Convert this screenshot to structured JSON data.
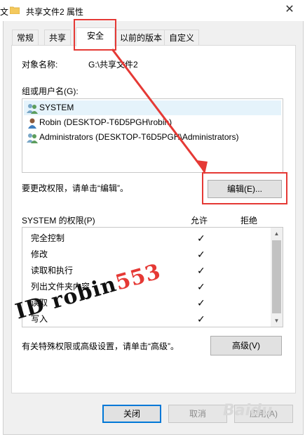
{
  "window": {
    "left_edge_char": "文",
    "title": "共享文件2 属性",
    "close": "✕"
  },
  "tabs": [
    {
      "label": "常规"
    },
    {
      "label": "共享"
    },
    {
      "label": "安全"
    },
    {
      "label": "以前的版本"
    },
    {
      "label": "自定义"
    }
  ],
  "security": {
    "object_name_label": "对象名称:",
    "object_name_value": "G:\\共享文件2",
    "group_label": "组或用户名(G):",
    "users": [
      {
        "name": "SYSTEM"
      },
      {
        "name": "Robin (DESKTOP-T6D5PGH\\robin)"
      },
      {
        "name": "Administrators (DESKTOP-T6D5PGH\\Administrators)"
      }
    ],
    "change_hint": "要更改权限，请单击“编辑”。",
    "edit_button": "编辑(E)...",
    "perm_label": "SYSTEM 的权限(P)",
    "allow_header": "允许",
    "deny_header": "拒绝",
    "permissions": [
      {
        "name": "完全控制",
        "allow": "✓"
      },
      {
        "name": "修改",
        "allow": "✓"
      },
      {
        "name": "读取和执行",
        "allow": "✓"
      },
      {
        "name": "列出文件夹内容",
        "allow": "✓"
      },
      {
        "name": "读取",
        "allow": "✓"
      },
      {
        "name": "写入",
        "allow": "✓"
      }
    ],
    "advanced_hint": "有关特殊权限或高级设置，请单击“高级”。",
    "advanced_button": "高级(V)"
  },
  "footer": {
    "close_button": "关闭",
    "cancel_button": "取消",
    "apply_button": "应用(A)"
  },
  "annotation": {
    "id_prefix": "ID",
    "id_name": "robin",
    "id_number": "553"
  },
  "watermark_site": "Baidu",
  "colors": {
    "annotation_red": "#e53935",
    "selection_blue": "#e5f3fb",
    "focus_blue": "#0078d7"
  }
}
